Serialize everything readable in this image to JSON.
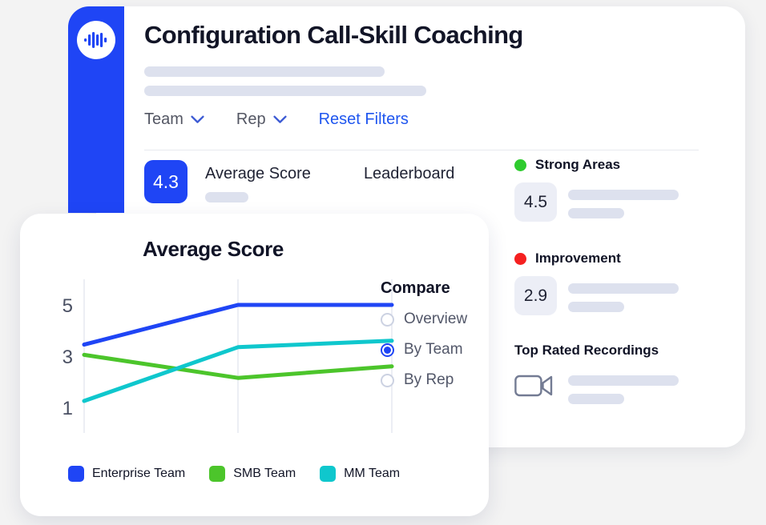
{
  "app": {
    "logo_icon": "audio-waveform-icon",
    "accent_blue": "#1f45f5",
    "link_blue": "#1f56ef"
  },
  "header": {
    "title": "Configuration Call-Skill Coaching",
    "placeholder_line_1": "",
    "placeholder_line_2": ""
  },
  "filters": {
    "team": {
      "label": "Team",
      "icon": "chevron-down-icon"
    },
    "rep": {
      "label": "Rep",
      "icon": "chevron-down-icon"
    },
    "reset": "Reset Filters"
  },
  "tabs": {
    "score_badge": "4.3",
    "average_score": "Average Score",
    "leaderboard": "Leaderboard"
  },
  "right_panel": {
    "strong_areas": {
      "title": "Strong Areas",
      "dot_color": "#2ecb2e",
      "value": "4.5"
    },
    "improvement": {
      "title": "Improvement",
      "dot_color": "#f52020",
      "value": "2.9"
    },
    "recordings": {
      "title": "Top Rated Recordings",
      "icon": "video-camera-icon"
    }
  },
  "chart_card": {
    "title": "Average Score",
    "compare": {
      "title": "Compare",
      "options": [
        {
          "label": "Overview",
          "selected": false
        },
        {
          "label": "By Team",
          "selected": true
        },
        {
          "label": "By Rep",
          "selected": false
        }
      ]
    }
  },
  "chart_data": {
    "type": "line",
    "title": "Average Score",
    "xlabel": "",
    "ylabel": "",
    "x": [
      1,
      2,
      3
    ],
    "ylim": [
      0,
      6
    ],
    "yticks": [
      1,
      3,
      5
    ],
    "ytick_labels": [
      "1",
      "3",
      "5"
    ],
    "grid": "vertical",
    "legend_position": "bottom",
    "series": [
      {
        "name": "Enterprise Team",
        "color": "#1f45f5",
        "values": [
          3.45,
          5.0,
          5.0
        ]
      },
      {
        "name": "SMB Team",
        "color": "#4cc52b",
        "values": [
          3.05,
          2.15,
          2.6
        ]
      },
      {
        "name": "MM Team",
        "color": "#0fc7cd",
        "values": [
          1.25,
          3.35,
          3.6
        ]
      }
    ]
  }
}
